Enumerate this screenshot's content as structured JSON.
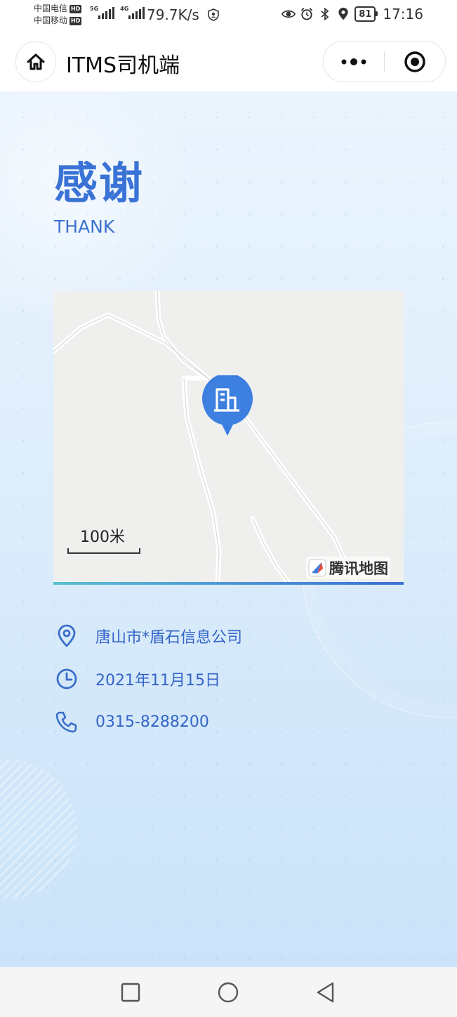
{
  "status_bar": {
    "carrier_1": "中国电信",
    "carrier_2": "中国移动",
    "hd_badge": "HD",
    "net_5g": "5G",
    "net_4g": "4G",
    "speed": "79.7K/s",
    "battery": "81",
    "time": "17:16"
  },
  "nav": {
    "title": "ITMS司机端"
  },
  "hero": {
    "title_cn": "感谢",
    "title_en": "THANK"
  },
  "map": {
    "scale_label": "100米",
    "brand": "腾讯地图"
  },
  "info": {
    "address": "唐山市*盾石信息公司",
    "date": "2021年11月15日",
    "phone": "0315-8288200"
  },
  "colors": {
    "accent": "#3a73d5",
    "marker": "#3a7de0"
  }
}
